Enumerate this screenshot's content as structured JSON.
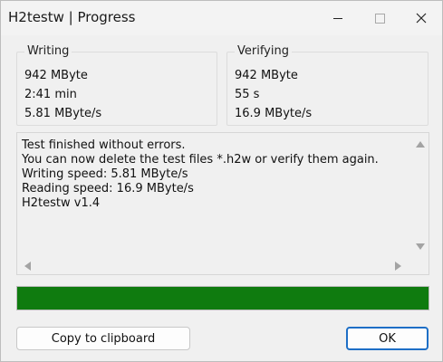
{
  "window": {
    "title": "H2testw | Progress",
    "controls": {
      "minimize": "minimize-icon",
      "maximize": "maximize-icon",
      "close": "close-icon"
    }
  },
  "writing": {
    "legend": "Writing",
    "size": "942 MByte",
    "time": "2:41 min",
    "speed": "5.81 MByte/s"
  },
  "verifying": {
    "legend": "Verifying",
    "size": "942 MByte",
    "time": "55 s",
    "speed": "16.9 MByte/s"
  },
  "log": {
    "lines": [
      "Test finished without errors.",
      "You can now delete the test files *.h2w or verify them again.",
      "Writing speed: 5.81 MByte/s",
      "Reading speed: 16.9 MByte/s",
      "H2testw v1.4"
    ]
  },
  "progress": {
    "fraction": 1.0,
    "color": "#0f7b0f"
  },
  "buttons": {
    "copy_label": "Copy to clipboard",
    "ok_label": "OK"
  }
}
